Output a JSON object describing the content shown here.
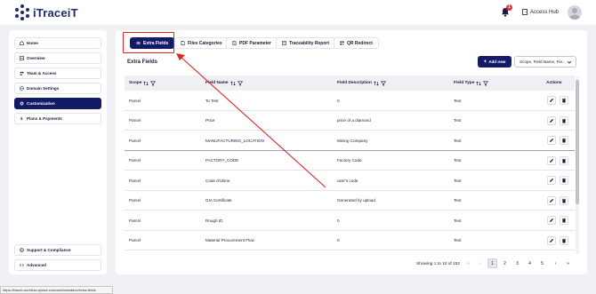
{
  "app": {
    "name": "iTraceiT",
    "notification_count": "1",
    "access_hub_label": "Access Hub"
  },
  "sidebar": {
    "items": [
      {
        "label": "Home"
      },
      {
        "label": "Overview"
      },
      {
        "label": "Team & Access"
      },
      {
        "label": "Domain Settings"
      },
      {
        "label": "Customization"
      },
      {
        "label": "Plans & Payments"
      }
    ],
    "bottom_items": [
      {
        "label": "Support & Compliance"
      },
      {
        "label": "Advanced"
      }
    ]
  },
  "tabs": [
    {
      "label": "Extra Fields"
    },
    {
      "label": "Files Categories"
    },
    {
      "label": "PDF Parameter"
    },
    {
      "label": "Traceability Report"
    },
    {
      "label": "QR Redirect"
    }
  ],
  "main": {
    "section_title": "Extra Fields",
    "add_button_label": "Add new",
    "search_select_value": "Scope, Field Name, Fie..."
  },
  "table": {
    "columns": [
      "Scope",
      "Field Name",
      "Field Description",
      "Field Type",
      "Actions"
    ],
    "rows": [
      {
        "scope": "Parcel",
        "field_name": "To Test",
        "description": "0",
        "type": "Text"
      },
      {
        "scope": "Parcel",
        "field_name": "Price",
        "description": "price of a diamond",
        "type": "Text"
      },
      {
        "scope": "Parcel",
        "field_name": "MANUFACTURING_LOCATION",
        "description": "Mining Company",
        "type": "Text"
      },
      {
        "scope": "Parcel",
        "field_name": "FACTORY_CODE",
        "description": "Factory Code",
        "type": "Text"
      },
      {
        "scope": "Parcel",
        "field_name": "Code d'Usine",
        "description": "user's code",
        "type": "Text"
      },
      {
        "scope": "Parcel",
        "field_name": "GIA Certificate",
        "description": "Generated by upload",
        "type": "Text"
      },
      {
        "scope": "Parcel",
        "field_name": "Rough ID",
        "description": "0",
        "type": "Text"
      },
      {
        "scope": "Parcel",
        "field_name": "Material Procurement Flow",
        "description": "0",
        "type": "Text"
      }
    ]
  },
  "pagination": {
    "summary": "Showing 1 to 10 of 152",
    "first": "«",
    "prev": "‹",
    "pages": [
      "1",
      "2",
      "3",
      "4",
      "5"
    ],
    "next": "›",
    "last": "»",
    "current": "1"
  },
  "status_bar": {
    "url": "https://itracei-workflow.dplace.com/administration/extra-fields"
  },
  "colors": {
    "accent": "#131a66",
    "highlight": "#e02424",
    "background": "#f0f1f4"
  }
}
